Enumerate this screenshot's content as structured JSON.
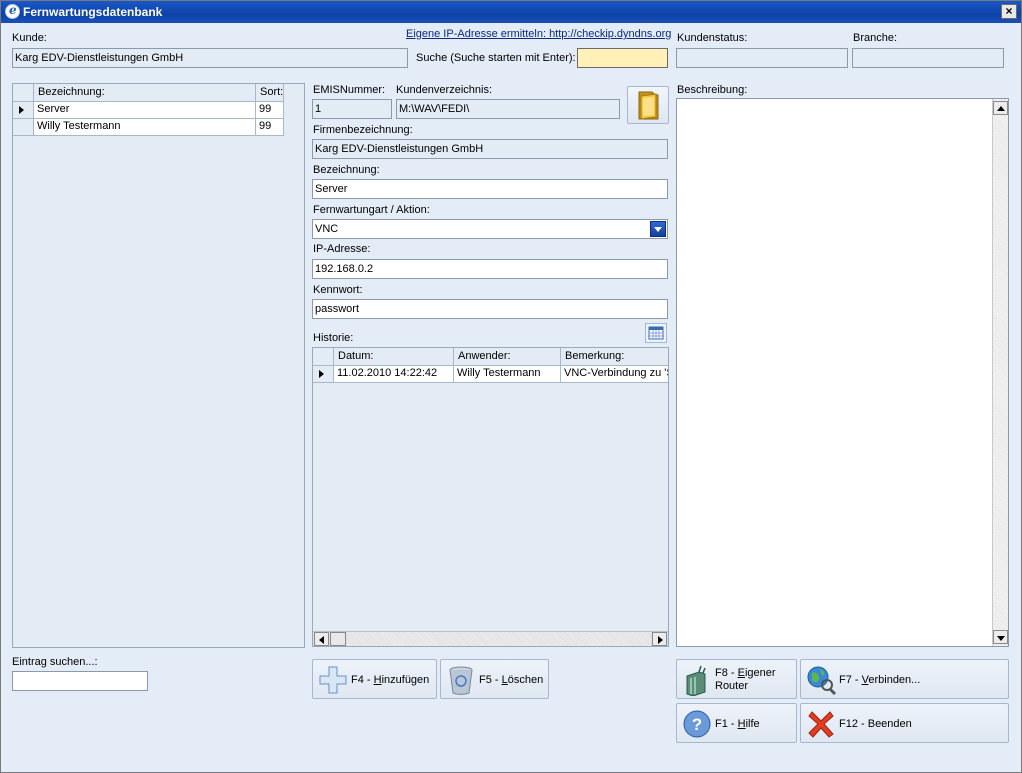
{
  "window": {
    "title": "Fernwartungsdatenbank",
    "close_glyph": "×"
  },
  "header": {
    "kunde_label": "Kunde:",
    "kunde_value": "Karg EDV-Dienstleistungen GmbH",
    "ip_link": "Eigene IP-Adresse ermitteln: http://checkip.dyndns.org",
    "search_label": "Suche (Suche starten mit Enter):",
    "search_value": "",
    "kundenstatus_label": "Kundenstatus:",
    "kundenstatus_value": "",
    "branche_label": "Branche:",
    "branche_value": ""
  },
  "entries_grid": {
    "columns": [
      "Bezeichnung:",
      "Sort:"
    ],
    "rows": [
      {
        "bezeichnung": "Server",
        "sort": "99",
        "current": true
      },
      {
        "bezeichnung": "Willy Testermann",
        "sort": "99",
        "current": false
      }
    ]
  },
  "entry_search": {
    "label": "Eintrag suchen...:",
    "value": ""
  },
  "detail": {
    "emis_label": "EMISNummer:",
    "emis_value": "1",
    "kundenverzeichnis_label": "Kundenverzeichnis:",
    "kundenverzeichnis_value": "M:\\WAV\\FEDI\\",
    "firmenbezeichnung_label": "Firmenbezeichnung:",
    "firmenbezeichnung_value": "Karg EDV-Dienstleistungen GmbH",
    "bezeichnung_label": "Bezeichnung:",
    "bezeichnung_value": "Server",
    "fernwartungsart_label": "Fernwartungart / Aktion:",
    "fernwartungsart_value": "VNC",
    "ip_label": "IP-Adresse:",
    "ip_value": "192.168.0.2",
    "kennwort_label": "Kennwort:",
    "kennwort_value": "passwort"
  },
  "history": {
    "label": "Historie:",
    "columns": [
      "Datum:",
      "Anwender:",
      "Bemerkung:"
    ],
    "rows": [
      {
        "datum": "11.02.2010 14:22:42",
        "anwender": "Willy Testermann",
        "bemerkung": "VNC-Verbindung zu 'S"
      }
    ]
  },
  "description": {
    "label": "Beschreibung:",
    "value": ""
  },
  "buttons": {
    "add": {
      "key": "F4 - ",
      "mnemonic": "H",
      "rest": "inzufügen"
    },
    "delete": {
      "key": "F5 - ",
      "mnemonic": "L",
      "rest": "öschen"
    },
    "router": {
      "line1_key": "F8 - ",
      "line1_mnemonic": "E",
      "line1_rest": "igener",
      "line2": "Router"
    },
    "connect": {
      "key": "F7 - ",
      "mnemonic": "V",
      "rest": "erbinden..."
    },
    "help": {
      "key": "F1 - ",
      "mnemonic": "H",
      "rest": "ilfe"
    },
    "exit": {
      "key": "F12 - Beenden"
    }
  },
  "colors": {
    "titlebar": "#0d43a8",
    "background": "#e4ecf7",
    "search_highlight": "#fff1b8"
  }
}
